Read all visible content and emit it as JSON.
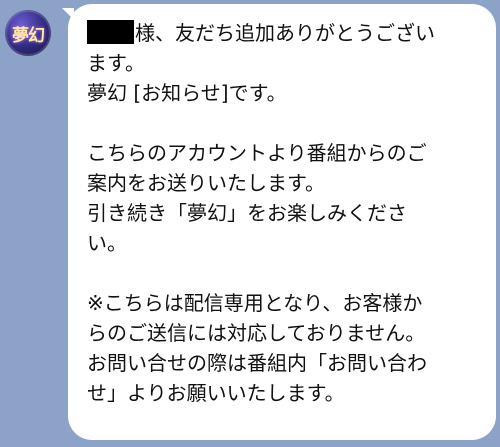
{
  "avatar": {
    "text": "夢幻"
  },
  "message": {
    "line1": "様、友だち追加ありがとうござい",
    "line2": "ます。",
    "line3": "夢幻 [お知らせ]です。",
    "line5": "こちらのアカウントより番組からのご",
    "line6": "案内をお送りいたします。",
    "line7": "引き続き「夢幻」をお楽しみくださ",
    "line8": "い。",
    "line10": "※こちらは配信専用となり、お客様か",
    "line11": "らのご送信には対応しておりません。",
    "line12": "お問い合せの際は番組内「お問い合わ",
    "line13": "せ」よりお願いいたします。"
  }
}
